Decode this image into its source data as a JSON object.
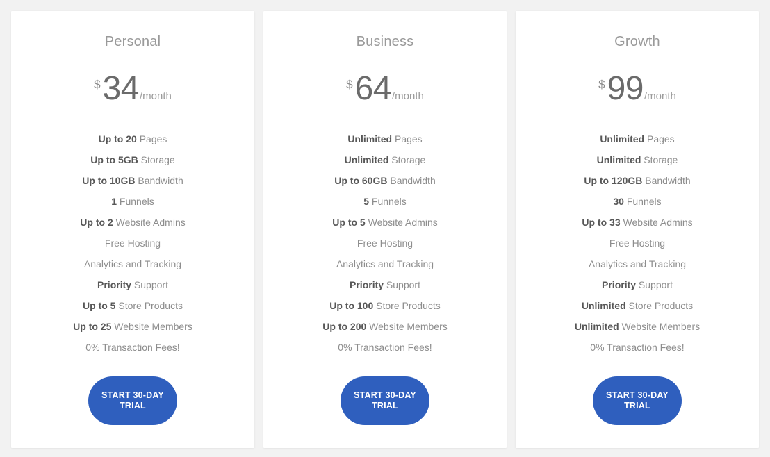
{
  "theme": {
    "page_background": "#f2f2f2",
    "card_background": "#ffffff",
    "accent": "#2f5fbe",
    "title_color": "#9a9a9a",
    "price_color": "#6b6b6b",
    "feature_color": "#8d8d8d",
    "feature_strong_color": "#575757"
  },
  "plans": [
    {
      "name": "Personal",
      "currency": "$",
      "price": "34",
      "period": "/month",
      "features": [
        {
          "strong": "Up to 20",
          "rest": " Pages"
        },
        {
          "strong": "Up to 5GB",
          "rest": " Storage"
        },
        {
          "strong": "Up to 10GB",
          "rest": " Bandwidth"
        },
        {
          "strong": "1",
          "rest": " Funnels"
        },
        {
          "strong": "Up to 2",
          "rest": " Website Admins"
        },
        {
          "strong": "",
          "rest": "Free Hosting"
        },
        {
          "strong": "",
          "rest": "Analytics and Tracking"
        },
        {
          "strong": "Priority",
          "rest": " Support"
        },
        {
          "strong": "Up to 5",
          "rest": " Store Products"
        },
        {
          "strong": "Up to 25",
          "rest": " Website Members"
        },
        {
          "strong": "",
          "rest": "0% Transaction Fees!"
        }
      ],
      "cta_label": "START 30-DAY TRIAL"
    },
    {
      "name": "Business",
      "currency": "$",
      "price": "64",
      "period": "/month",
      "features": [
        {
          "strong": "Unlimited",
          "rest": " Pages"
        },
        {
          "strong": "Unlimited",
          "rest": " Storage"
        },
        {
          "strong": "Up to 60GB",
          "rest": " Bandwidth"
        },
        {
          "strong": "5",
          "rest": " Funnels"
        },
        {
          "strong": "Up to 5",
          "rest": " Website Admins"
        },
        {
          "strong": "",
          "rest": "Free Hosting"
        },
        {
          "strong": "",
          "rest": "Analytics and Tracking"
        },
        {
          "strong": "Priority",
          "rest": " Support"
        },
        {
          "strong": "Up to 100",
          "rest": " Store Products"
        },
        {
          "strong": "Up to 200",
          "rest": " Website Members"
        },
        {
          "strong": "",
          "rest": "0% Transaction Fees!"
        }
      ],
      "cta_label": "START 30-DAY TRIAL"
    },
    {
      "name": "Growth",
      "currency": "$",
      "price": "99",
      "period": "/month",
      "features": [
        {
          "strong": "Unlimited",
          "rest": " Pages"
        },
        {
          "strong": "Unlimited",
          "rest": " Storage"
        },
        {
          "strong": "Up to 120GB",
          "rest": " Bandwidth"
        },
        {
          "strong": "30",
          "rest": " Funnels"
        },
        {
          "strong": "Up to 33",
          "rest": " Website Admins"
        },
        {
          "strong": "",
          "rest": "Free Hosting"
        },
        {
          "strong": "",
          "rest": "Analytics and Tracking"
        },
        {
          "strong": "Priority",
          "rest": " Support"
        },
        {
          "strong": "Unlimited",
          "rest": " Store Products"
        },
        {
          "strong": "Unlimited",
          "rest": " Website Members"
        },
        {
          "strong": "",
          "rest": "0% Transaction Fees!"
        }
      ],
      "cta_label": "START 30-DAY TRIAL"
    }
  ]
}
